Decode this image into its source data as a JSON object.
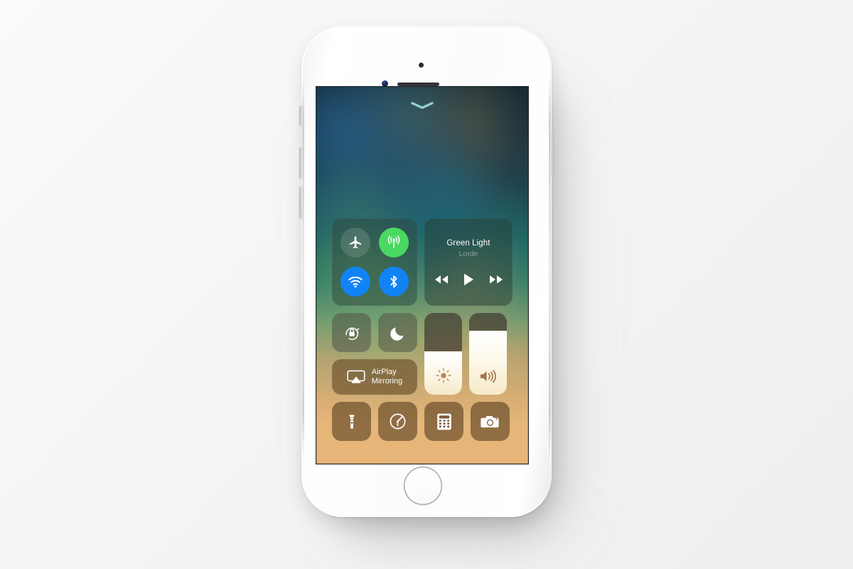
{
  "device": {
    "name": "iPhone",
    "color_finish": "silver",
    "hardware": {
      "front_camera": "front-camera",
      "earpiece": "earpiece-speaker",
      "proximity_sensor": "proximity-sensor",
      "home_button": "home-button",
      "mute_switch": "mute-switch",
      "volume_up": "volume-up-button",
      "volume_down": "volume-down-button",
      "power": "power-button"
    }
  },
  "screen": {
    "wallpaper_colors": {
      "top": "#0d2634",
      "mid_teal": "#1d6a62",
      "green": "#76a474",
      "bottom_amber": "#e6b272"
    }
  },
  "control_center": {
    "handle_icon": "chevron-down-icon",
    "handle_color": "#8fd2d2",
    "connectivity": {
      "toggles": [
        {
          "name": "airplane-mode",
          "icon": "airplane-icon",
          "state": "off",
          "color": "rgba(255,255,255,0.13)"
        },
        {
          "name": "cellular-data",
          "icon": "cellular-antenna-icon",
          "state": "on",
          "color": "#4ad863"
        },
        {
          "name": "wifi",
          "icon": "wifi-icon",
          "state": "on",
          "color": "#1283f5"
        },
        {
          "name": "bluetooth",
          "icon": "bluetooth-icon",
          "state": "on",
          "color": "#1283f5"
        }
      ]
    },
    "now_playing": {
      "title": "Green Light",
      "artist": "Lorde",
      "controls": [
        {
          "name": "rewind",
          "icon": "rewind-icon"
        },
        {
          "name": "play",
          "icon": "play-icon"
        },
        {
          "name": "fast-forward",
          "icon": "fast-forward-icon"
        }
      ]
    },
    "toggles_row2": [
      {
        "name": "rotation-lock",
        "icon": "rotation-lock-icon",
        "state": "off"
      },
      {
        "name": "do-not-disturb",
        "icon": "moon-icon",
        "state": "off"
      }
    ],
    "airplay": {
      "label": "AirPlay\nMirroring",
      "icon": "airplay-icon"
    },
    "sliders": [
      {
        "name": "brightness",
        "icon": "brightness-sun-icon",
        "value": 53,
        "unit": "%"
      },
      {
        "name": "volume",
        "icon": "volume-speaker-icon",
        "value": 78,
        "unit": "%"
      }
    ],
    "shortcuts": [
      {
        "name": "flashlight",
        "icon": "flashlight-icon"
      },
      {
        "name": "timer",
        "icon": "timer-icon"
      },
      {
        "name": "calculator",
        "icon": "calculator-icon"
      },
      {
        "name": "camera",
        "icon": "camera-icon"
      }
    ]
  }
}
